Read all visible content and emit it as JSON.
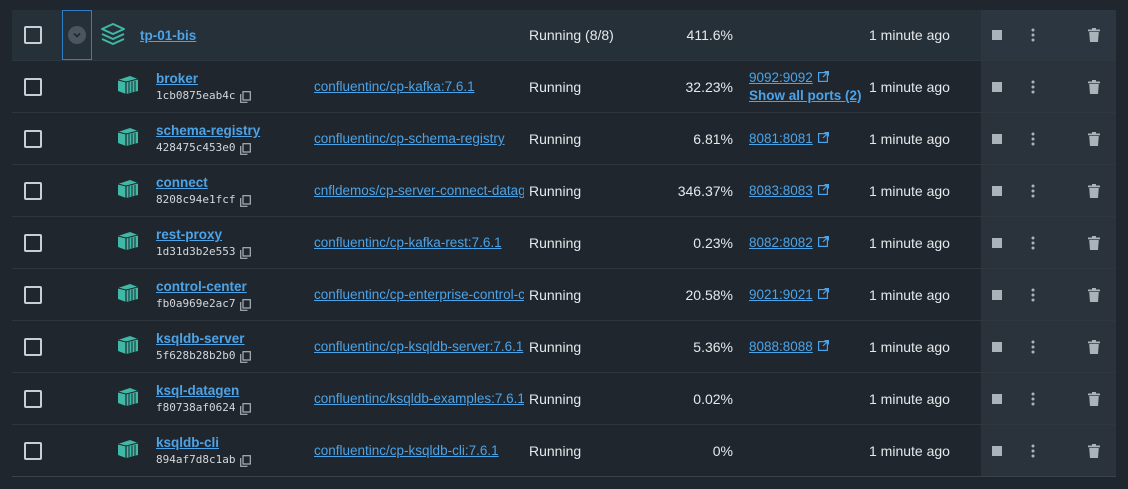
{
  "group": {
    "name": "tp-01-bis",
    "status": "Running (8/8)",
    "cpu": "411.6%",
    "last_started": "1 minute ago",
    "expander_icon": "chevron-down-icon",
    "stack_icon": "stack-icon"
  },
  "containers": [
    {
      "name": "broker",
      "id": "1cb0875eab4c",
      "image": "confluentinc/cp-kafka:7.6.1",
      "status": "Running",
      "cpu": "32.23%",
      "port": "9092:9092",
      "show_ports": "Show all ports (2)",
      "last_started": "1 minute ago"
    },
    {
      "name": "schema-registry",
      "id": "428475c453e0",
      "image": "confluentinc/cp-schema-registry",
      "status": "Running",
      "cpu": "6.81%",
      "port": "8081:8081",
      "show_ports": "",
      "last_started": "1 minute ago"
    },
    {
      "name": "connect",
      "id": "8208c94e1fcf",
      "image": "cnfldemos/cp-server-connect-datagen",
      "status": "Running",
      "cpu": "346.37%",
      "port": "8083:8083",
      "show_ports": "",
      "last_started": "1 minute ago"
    },
    {
      "name": "rest-proxy",
      "id": "1d31d3b2e553",
      "image": "confluentinc/cp-kafka-rest:7.6.1",
      "status": "Running",
      "cpu": "0.23%",
      "port": "8082:8082",
      "show_ports": "",
      "last_started": "1 minute ago"
    },
    {
      "name": "control-center",
      "id": "fb0a969e2ac7",
      "image": "confluentinc/cp-enterprise-control-center",
      "status": "Running",
      "cpu": "20.58%",
      "port": "9021:9021",
      "show_ports": "",
      "last_started": "1 minute ago"
    },
    {
      "name": "ksqldb-server",
      "id": "5f628b28b2b0",
      "image": "confluentinc/cp-ksqldb-server:7.6.1",
      "status": "Running",
      "cpu": "5.36%",
      "port": "8088:8088",
      "show_ports": "",
      "last_started": "1 minute ago"
    },
    {
      "name": "ksql-datagen",
      "id": "f80738af0624",
      "image": "confluentinc/ksqldb-examples:7.6.1",
      "status": "Running",
      "cpu": "0.02%",
      "port": "",
      "show_ports": "",
      "last_started": "1 minute ago"
    },
    {
      "name": "ksqldb-cli",
      "id": "894af7d8c1ab",
      "image": "confluentinc/cp-ksqldb-cli:7.6.1",
      "status": "Running",
      "cpu": "0%",
      "port": "",
      "show_ports": "",
      "last_started": "1 minute ago"
    }
  ],
  "icons": {
    "container": "container-icon",
    "copy": "copy-icon",
    "external": "external-link-icon",
    "stop": "stop-icon",
    "more": "more-vertical-icon",
    "delete": "trash-icon"
  },
  "colors": {
    "accent": "#4ca3e8",
    "container_icon": "#3fb8a6",
    "background": "#1f262d"
  }
}
